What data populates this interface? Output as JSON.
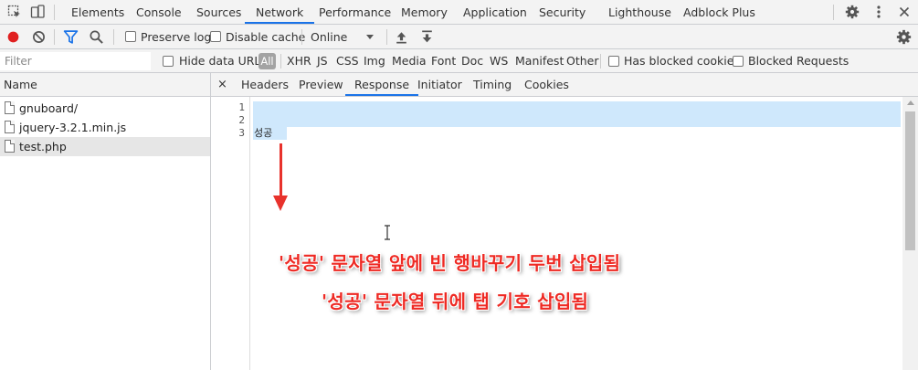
{
  "devtools": {
    "panel_tabs": [
      "Elements",
      "Console",
      "Sources",
      "Network",
      "Performance",
      "Memory",
      "Application",
      "Security",
      "Lighthouse",
      "Adblock Plus"
    ],
    "active_panel": "Network",
    "icons": [
      "inspect-element-icon",
      "device-toggle-icon",
      "settings-gear-icon",
      "kebab-menu-icon",
      "close-icon"
    ]
  },
  "toolbar": {
    "preserve_log_label": "Preserve log",
    "disable_cache_label": "Disable cache",
    "throttling_value": "Online",
    "icons": [
      "record-icon",
      "clear-icon",
      "filter-icon",
      "search-icon",
      "import-har-icon",
      "export-har-icon",
      "network-settings-icon"
    ]
  },
  "filterbar": {
    "placeholder": "Filter",
    "hide_data_urls_label": "Hide data URLs",
    "types": [
      "All",
      "XHR",
      "JS",
      "CSS",
      "Img",
      "Media",
      "Font",
      "Doc",
      "WS",
      "Manifest",
      "Other"
    ],
    "active_type": "All",
    "has_blocked_cookies_label": "Has blocked cookies",
    "blocked_requests_label": "Blocked Requests"
  },
  "request_list": {
    "column_name": "Name",
    "requests": [
      {
        "name": "gnuboard/",
        "selected": false
      },
      {
        "name": "jquery-3.2.1.min.js",
        "selected": false
      },
      {
        "name": "test.php",
        "selected": true
      }
    ]
  },
  "detail": {
    "close_symbol": "×",
    "tabs": [
      "Headers",
      "Preview",
      "Response",
      "Initiator",
      "Timing",
      "Cookies"
    ],
    "active_tab": "Response",
    "lines": [
      {
        "number": "1",
        "text": ""
      },
      {
        "number": "2",
        "text": ""
      },
      {
        "number": "3",
        "text": "성공"
      }
    ]
  },
  "annotation": {
    "line1": "'성공' 문자열 앞에 빈 행바꾸기 두번 삽입됨",
    "line2": "'성공' 문자열 뒤에 탭 기호 삽입됨",
    "color": "#ee2a24"
  }
}
